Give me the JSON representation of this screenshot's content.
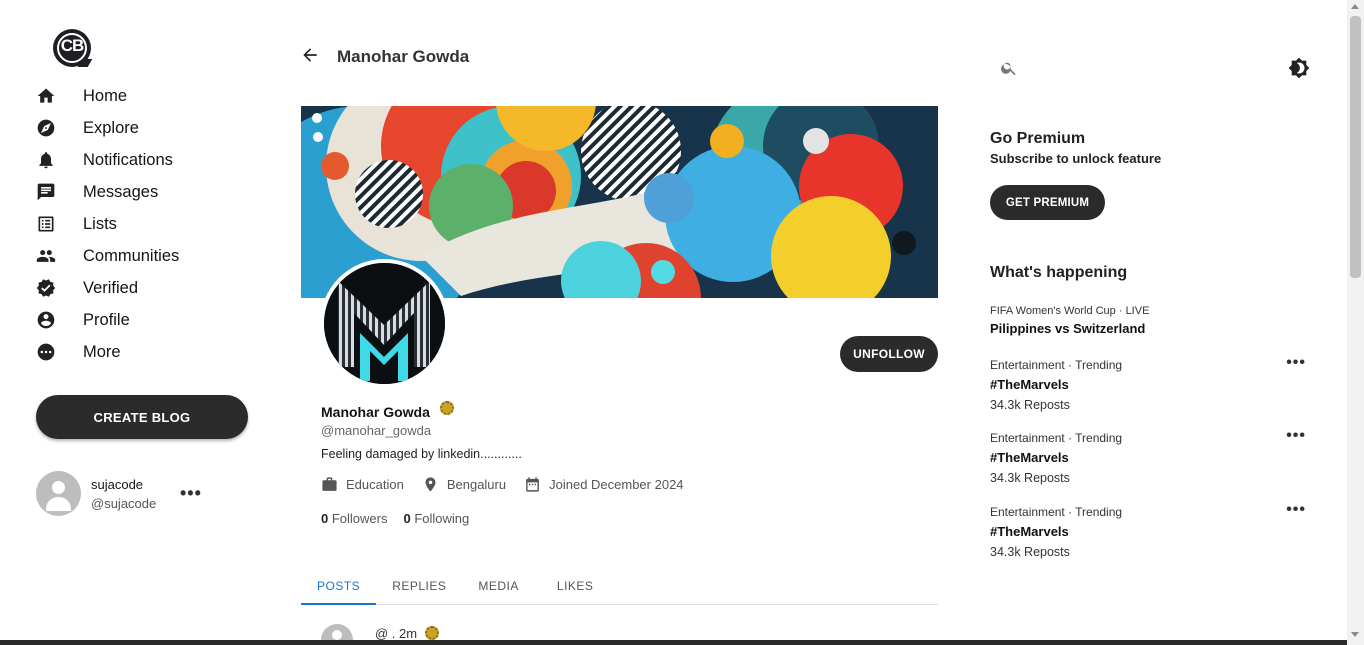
{
  "sidebar": {
    "items": [
      {
        "label": "Home",
        "icon": "home-icon"
      },
      {
        "label": "Explore",
        "icon": "compass-icon"
      },
      {
        "label": "Notifications",
        "icon": "bell-icon"
      },
      {
        "label": "Messages",
        "icon": "message-icon"
      },
      {
        "label": "Lists",
        "icon": "list-icon"
      },
      {
        "label": "Communities",
        "icon": "people-icon"
      },
      {
        "label": "Verified",
        "icon": "verified-icon"
      },
      {
        "label": "Profile",
        "icon": "account-icon"
      },
      {
        "label": "More",
        "icon": "more-icon"
      }
    ],
    "create_blog_label": "CREATE BLOG",
    "user": {
      "name": "sujacode",
      "handle": "@sujacode"
    }
  },
  "main": {
    "title": "Manohar Gowda",
    "profile": {
      "name": "Manohar Gowda",
      "handle": "@manohar_gowda",
      "bio": "Feeling damaged by linkedin............",
      "occupation": "Education",
      "location": "Bengaluru",
      "joined": "Joined December 2024",
      "followers_count": "0",
      "followers_label": "Followers",
      "following_count": "0",
      "following_label": "Following",
      "unfollow_label": "UNFOLLOW"
    },
    "tabs": [
      {
        "label": "POSTS",
        "active": true
      },
      {
        "label": "REPLIES",
        "active": false
      },
      {
        "label": "MEDIA",
        "active": false
      },
      {
        "label": "LIKES",
        "active": false
      }
    ],
    "post_preview": {
      "meta": "@ . 2m"
    }
  },
  "right": {
    "search": {
      "placeholder": "",
      "value": ""
    },
    "premium": {
      "title": "Go Premium",
      "subtitle": "Subscribe to unlock feature",
      "button_label": "GET PREMIUM"
    },
    "whats_happening": {
      "title": "What's happening",
      "trends": [
        {
          "meta": "FIFA Women's World Cup · LIVE",
          "title": "Pilippines vs Switzerland",
          "count": "",
          "has_menu": false
        },
        {
          "meta": "Entertainment · Trending",
          "title": "#TheMarvels",
          "count": "34.3k Reposts",
          "has_menu": true
        },
        {
          "meta": "Entertainment · Trending",
          "title": "#TheMarvels",
          "count": "34.3k Reposts",
          "has_menu": true
        },
        {
          "meta": "Entertainment · Trending",
          "title": "#TheMarvels",
          "count": "34.3k Reposts",
          "has_menu": true
        }
      ]
    }
  },
  "colors": {
    "primary_button": "#2b2b2b",
    "active_tab": "#1976d2",
    "badge": "#c9a227"
  }
}
